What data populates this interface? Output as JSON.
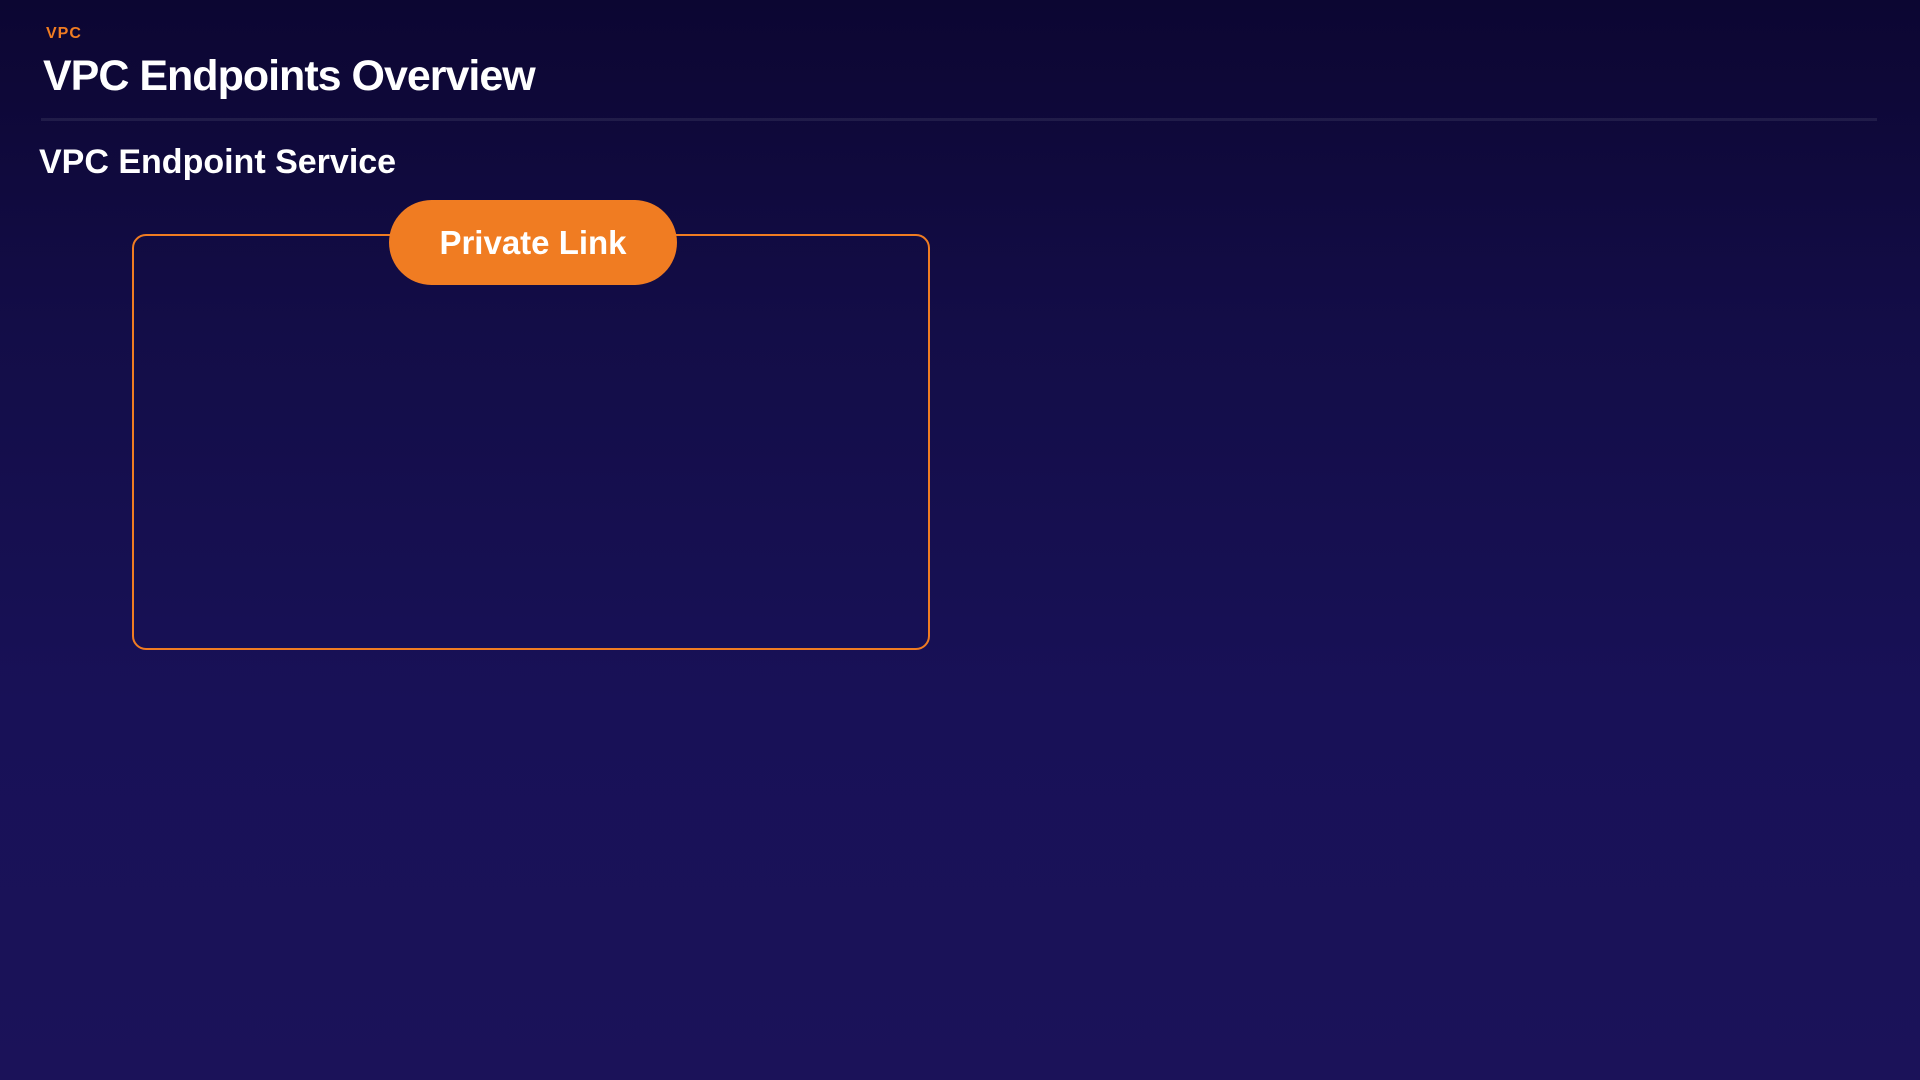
{
  "header": {
    "eyebrow": "VPC",
    "title": "VPC Endpoints Overview"
  },
  "section": {
    "title": "VPC Endpoint Service"
  },
  "diagram": {
    "service_label": "Private Link"
  },
  "colors": {
    "accent": "#f07c22",
    "background_top": "#0c0632",
    "background_bottom": "#1b1259",
    "text": "#ffffff"
  }
}
